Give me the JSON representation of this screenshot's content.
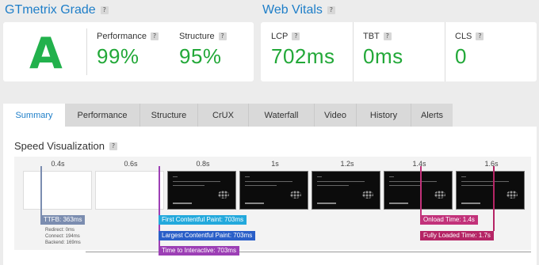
{
  "grade": {
    "title": "GTmetrix Grade",
    "help": "?",
    "letter": "A",
    "metrics": [
      {
        "label": "Performance",
        "value": "99%"
      },
      {
        "label": "Structure",
        "value": "95%"
      }
    ]
  },
  "vitals": {
    "title": "Web Vitals",
    "help": "?",
    "metrics": [
      {
        "label": "LCP",
        "value": "702ms"
      },
      {
        "label": "TBT",
        "value": "0ms"
      },
      {
        "label": "CLS",
        "value": "0"
      }
    ]
  },
  "tabs": [
    "Summary",
    "Performance",
    "Structure",
    "CrUX",
    "Waterfall",
    "Video",
    "History",
    "Alerts"
  ],
  "active_tab": "Summary",
  "speed": {
    "title": "Speed Visualization",
    "help": "?",
    "ticks": [
      "0.4s",
      "0.6s",
      "0.8s",
      "1s",
      "1.2s",
      "1.4s",
      "1.6s"
    ],
    "ttfb": {
      "label": "TTFB: 363ms",
      "details": [
        "Redirect: 0ms",
        "Connect: 194ms",
        "Backend: 169ms"
      ]
    },
    "fcp": "First Contentful Paint: 703ms",
    "lcp": "Largest Contentful Paint: 703ms",
    "tti": "Time to Interactive: 703ms",
    "onload": "Onload Time: 1.4s",
    "fully_loaded": "Fully Loaded Time: 1.7s"
  },
  "colors": {
    "accent": "#1e7ec8",
    "good": "#22a838",
    "ttfb": "#7b8db0",
    "fcp": "#23a9dc",
    "lcp": "#2a5fc8",
    "tti": "#9c3fb5",
    "onload": "#c2327a",
    "fully": "#b52565"
  }
}
